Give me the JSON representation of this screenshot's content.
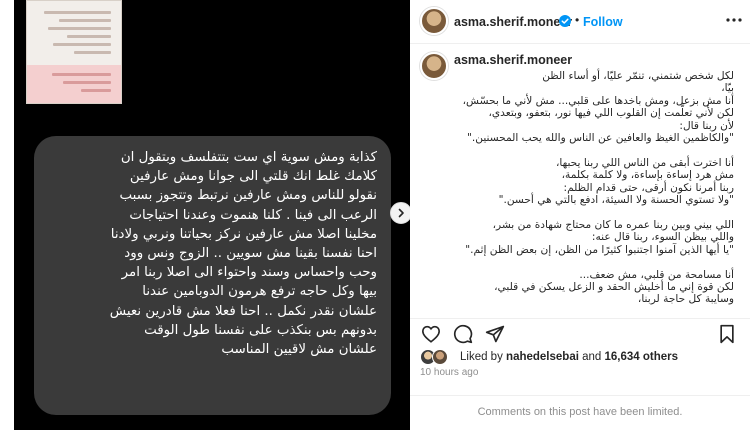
{
  "post": {
    "image_text": "كذابة ومش سوية اي ست بتتفلسف وبتقول ان\nكلامك غلط انك قلتي الى جوانا ومش عارفين\nنقولو للناس ومش عارفين نرتبط وتتجوز بسبب\nالرعب الى فينا . كلنا هنموت وعندنا احتياجات\nمخلينا اصلا مش عارفين نركز بحياتنا ونربي ولادنا\nاحنا نفسنا بقينا مش سويين .. الزوج ونس وود\nوحب واحساس وسند واحتواء الى اصلا ربنا امر\nبيها  وكل حاجه ترفع هرمون الدوبامين عندنا\nعلشان نقدر نكمل .. احنا فعلا مش قادرين نعيش\nبدونهم بس بنكذب على نفسنا طول الوقت\nعلشان مش لاقيين المناسب"
  },
  "header": {
    "username": "asma.sherif.moneer",
    "separator": "•",
    "follow_label": "Follow"
  },
  "caption": {
    "username": "asma.sherif.moneer",
    "text": "لكل شخص شتمني، تنمّر عليّا، أو أساء الظن\nبيّا،\nأنا مش بزعل، ومش باخدها على قلبي... مش لأني ما بحسّش،\nلكن لأني تعلّمت إن القلوب اللي فيها نور، بتعفو، وبتعدي،\nلأن ربنا قال:\n\"والكاظمين الغيظ والعافين عن الناس والله يحب المحسنين.\"\n\nأنا اخترت أبقى من الناس اللي ربنا يحبها،\nمش هرد إساءة بإساءة، ولا كلمة بكلمة،\nربنا أمرنا نكون أرقى، حتى قدام الظلم:\n\"ولا تستوي الحسنة ولا السيئة، ادفع بالتي هي أحسن.\"\n\nاللي بيني وبين ربنا عمره ما كان محتاج شهادة من بشر،\nواللي بيظن السوء، ربنا قال عنه:\n\"يا أيها الذين آمنوا اجتنبوا كثيرًا من الظن، إن بعض الظن إثم.\"\n\nأنا مسامحة من قلبي، مش ضعف...\nلكن قوة إني ما أخليش الحقد و الزعل يسكن في قلبي،\nوسايبة كل حاجة لربنا،"
  },
  "likes": {
    "prefix": "Liked by",
    "user": "nahedelsebai",
    "middle": "and",
    "others": "16,634 others"
  },
  "timestamp": "10 hours ago",
  "comments_notice": "Comments on this post have been limited.",
  "icons": {
    "verified": "verified-badge-icon",
    "more": "more-options-icon",
    "like": "heart-icon",
    "comment": "comment-icon",
    "share": "share-icon",
    "save": "bookmark-icon",
    "next": "chevron-right-icon"
  },
  "colors": {
    "accent": "#0095f6",
    "bubble": "#3a3a3a",
    "text": "#262626",
    "muted": "#8e8e8e"
  }
}
